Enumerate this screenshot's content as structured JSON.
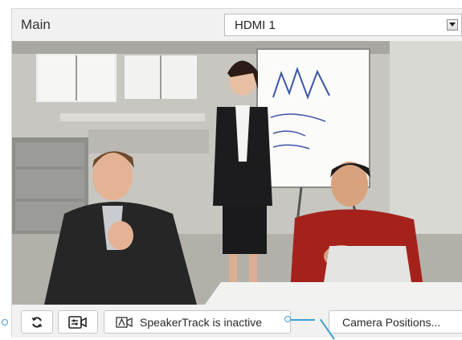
{
  "panel": {
    "title": "Main",
    "source_select": {
      "value": "HDMI 1"
    }
  },
  "toolbar": {
    "speakertrack_label": "SpeakerTrack is inactive",
    "camera_positions_label": "Camera Positions..."
  },
  "icons": {
    "refresh": "refresh-icon",
    "camera_preset": "camera-preset-icon",
    "speakertrack": "speakertrack-icon",
    "dropdown": "dropdown-arrow-icon"
  },
  "colors": {
    "panel_bg": "#f1f1f1",
    "button_bg": "#ffffff",
    "callout": "#3f9fcf",
    "text": "#2a2a2a"
  }
}
